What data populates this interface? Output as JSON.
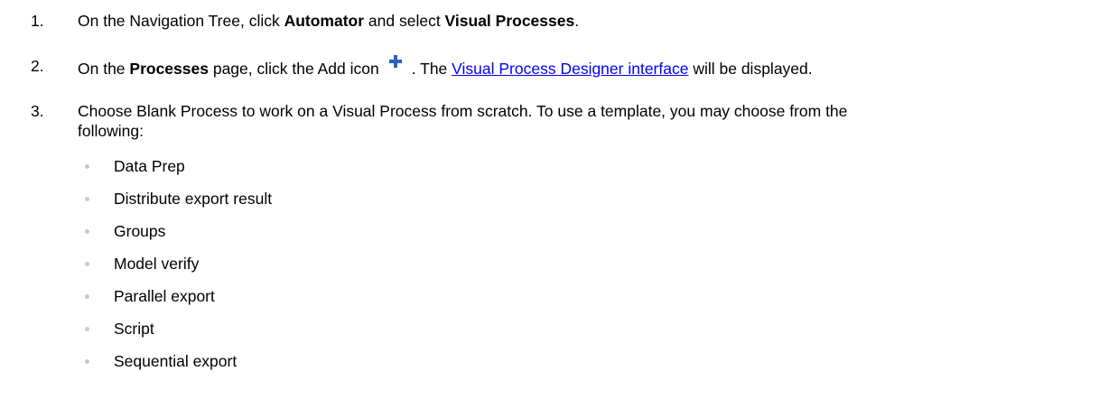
{
  "steps": [
    {
      "number": "1.",
      "pre": "On the Navigation Tree, click ",
      "bold1": "Automator",
      "mid": " and select ",
      "bold2": "Visual Processes",
      "post": "."
    },
    {
      "number": "2.",
      "pre": "On the ",
      "bold1": "Processes",
      "mid": " page, click the Add icon",
      "icon": "add-plus-icon",
      "after_icon": ". The ",
      "link": "Visual Process Designer interface",
      "post": " will be displayed."
    },
    {
      "number": "3.",
      "text_line1": "Choose Blank Process to work on a Visual Process from scratch. To use a template, you may choose from the",
      "text_line2": "following:"
    }
  ],
  "templates": [
    "Data Prep",
    "Distribute export result",
    "Groups",
    "Model verify",
    "Parallel export",
    "Script",
    "Sequential export"
  ],
  "colors": {
    "link": "#0000ee",
    "bullet": "#c8c8c8",
    "icon": "#2a5fc9"
  }
}
